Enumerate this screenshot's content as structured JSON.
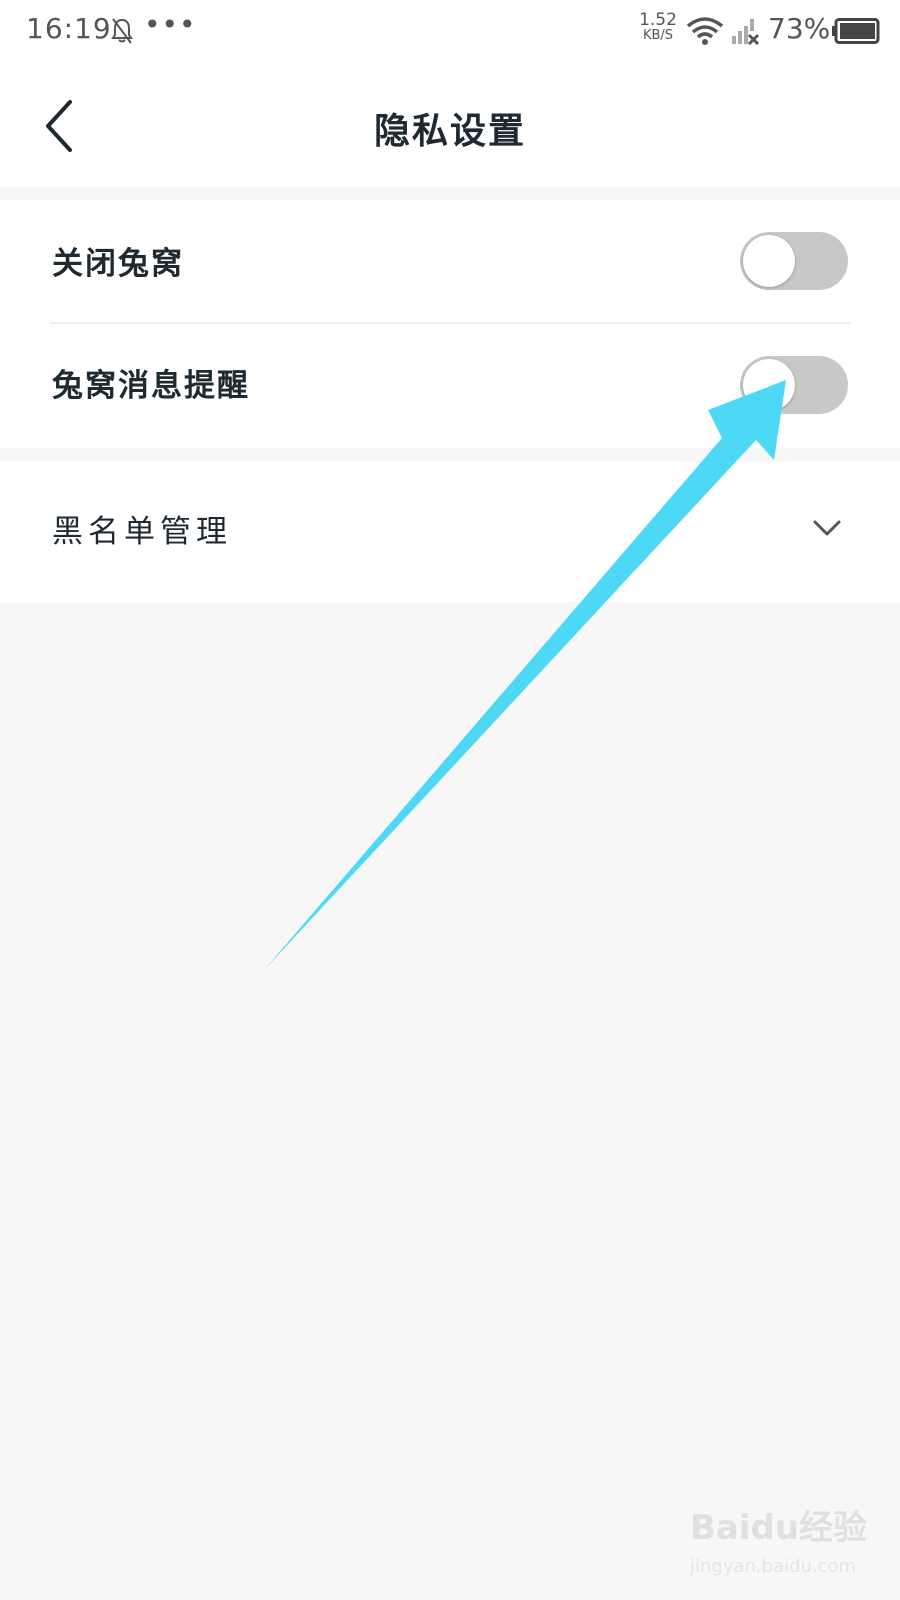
{
  "status_bar": {
    "time": "16:19",
    "more": "•••",
    "net_speed_value": "1.52",
    "net_speed_unit": "KB/S",
    "battery_percent": "73%",
    "icons": [
      "bell-off-icon",
      "wifi-icon",
      "cellular-signal-off-icon",
      "battery-icon"
    ]
  },
  "header": {
    "title": "隐私设置",
    "back_icon": "chevron-left-icon"
  },
  "settings": {
    "close_burrow": {
      "label": "关闭兔窝",
      "enabled": false
    },
    "burrow_message_reminder": {
      "label": "兔窝消息提醒",
      "enabled": false
    },
    "blacklist": {
      "label": "黑名单管理",
      "icon": "chevron-down-icon"
    }
  },
  "annotation": {
    "icon": "pointer-arrow",
    "color": "#4dd8f5"
  },
  "watermark": {
    "main": "Baidu经验",
    "sub": "jingyan.baidu.com"
  }
}
